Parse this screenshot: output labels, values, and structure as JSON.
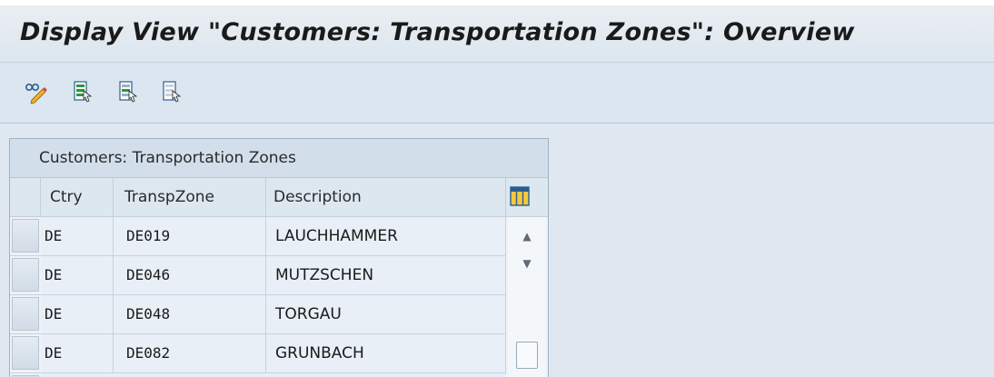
{
  "window": {
    "title": "Display View \"Customers: Transportation Zones\": Overview"
  },
  "toolbar": {
    "buttons": [
      {
        "name": "display-change-icon"
      },
      {
        "name": "select-all-icon"
      },
      {
        "name": "select-block-icon"
      },
      {
        "name": "deselect-all-icon"
      }
    ]
  },
  "table": {
    "title": "Customers: Transportation Zones",
    "columns": [
      "Ctry",
      "TranspZone",
      "Description"
    ],
    "rows": [
      {
        "ctry": "DE",
        "zone": "DE019",
        "desc": "LAUCHHAMMER"
      },
      {
        "ctry": "DE",
        "zone": "DE046",
        "desc": "MUTZSCHEN"
      },
      {
        "ctry": "DE",
        "zone": "DE048",
        "desc": "TORGAU"
      },
      {
        "ctry": "DE",
        "zone": "DE082",
        "desc": "GRUNBACH"
      }
    ]
  },
  "colors": {
    "accent": "#3b7cc4",
    "background": "#dfe8f1"
  }
}
